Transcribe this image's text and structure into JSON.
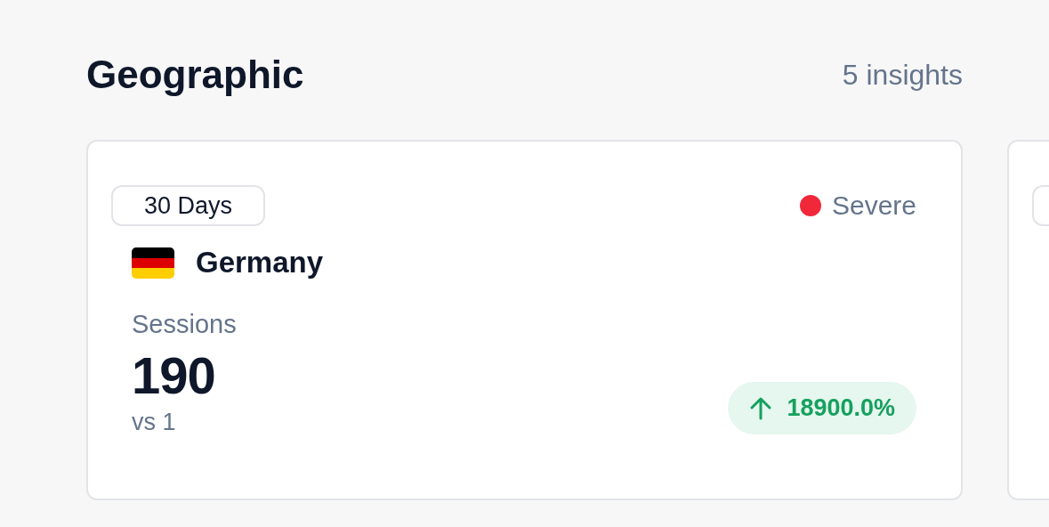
{
  "section": {
    "title": "Geographic",
    "count": "5 insights"
  },
  "cards": [
    {
      "kind": "insight",
      "period": "30 Days",
      "severity": {
        "label": "Severe",
        "color": "#f0283a"
      },
      "country": "Germany",
      "metric": "Sessions",
      "value": "190",
      "comparison": "vs 1",
      "change": {
        "increase": true,
        "label": "18900.0%"
      }
    },
    {
      "kind": "clipped"
    }
  ]
}
